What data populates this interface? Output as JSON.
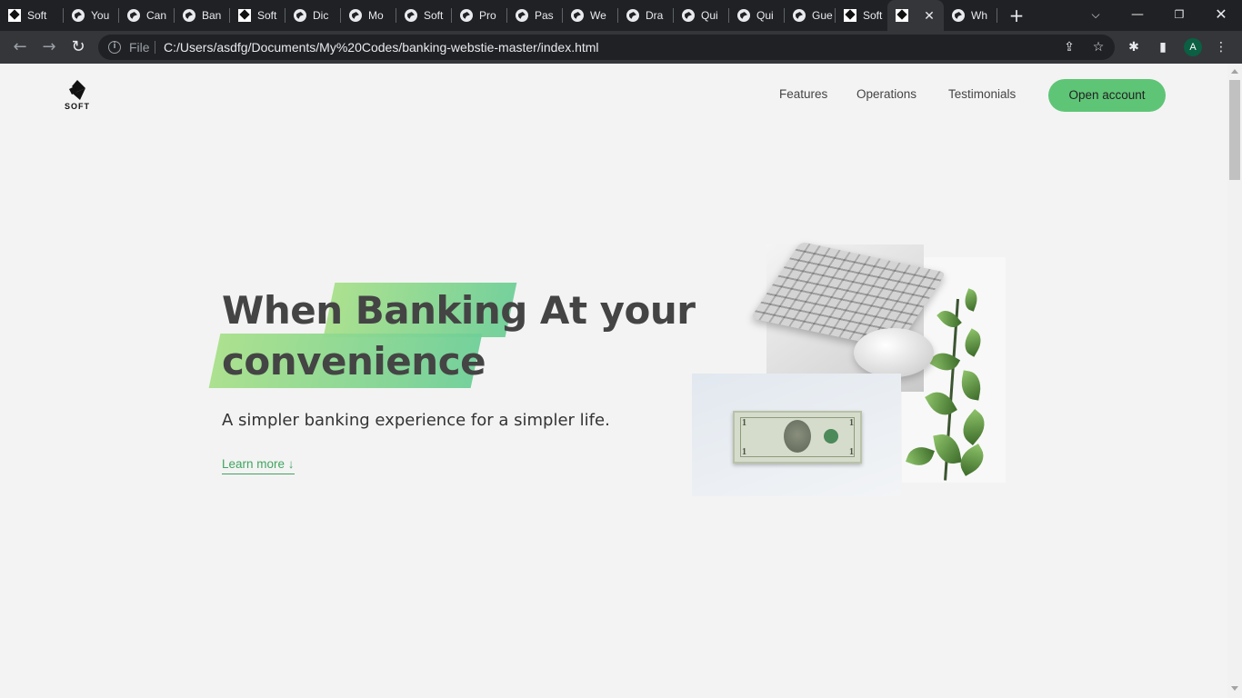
{
  "browser": {
    "tabs": [
      {
        "title": "Soft",
        "icon": "soft-icon"
      },
      {
        "title": "You",
        "icon": "globe-icon"
      },
      {
        "title": "Can",
        "icon": "globe-icon"
      },
      {
        "title": "Ban",
        "icon": "globe-icon"
      },
      {
        "title": "Soft",
        "icon": "soft-icon"
      },
      {
        "title": "Dic",
        "icon": "globe-icon"
      },
      {
        "title": "Mo",
        "icon": "globe-icon"
      },
      {
        "title": "Soft",
        "icon": "globe-icon"
      },
      {
        "title": "Pro",
        "icon": "globe-icon"
      },
      {
        "title": "Pas",
        "icon": "globe-icon"
      },
      {
        "title": "We",
        "icon": "globe-icon"
      },
      {
        "title": "Dra",
        "icon": "globe-icon"
      },
      {
        "title": "Qui",
        "icon": "globe-icon"
      },
      {
        "title": "Qui",
        "icon": "globe-icon"
      },
      {
        "title": "Gue",
        "icon": "globe-icon"
      },
      {
        "title": "Soft",
        "icon": "soft-icon"
      },
      {
        "title": "",
        "icon": "soft-icon",
        "active": true
      },
      {
        "title": "Wh",
        "icon": "globe-icon"
      }
    ],
    "url_scheme_label": "File",
    "url": "C:/Users/asdfg/Documents/My%20Codes/banking-webstie-master/index.html",
    "profile_initial": "A"
  },
  "site": {
    "logo_text": "SOFT",
    "nav": [
      "Features",
      "Operations",
      "Testimonials"
    ],
    "cta_label": "Open account"
  },
  "hero": {
    "title_part1": "When ",
    "title_highlight1": "Banking",
    "title_part2": " At your",
    "title_highlight2": "convenience",
    "subtitle": "A simpler banking experience for a simpler life.",
    "learn_more": "Learn more ↓"
  },
  "colors": {
    "accent": "#5ec576",
    "highlight_start": "#a8e08a",
    "highlight_end": "#6fcf97",
    "heading": "#444444"
  }
}
